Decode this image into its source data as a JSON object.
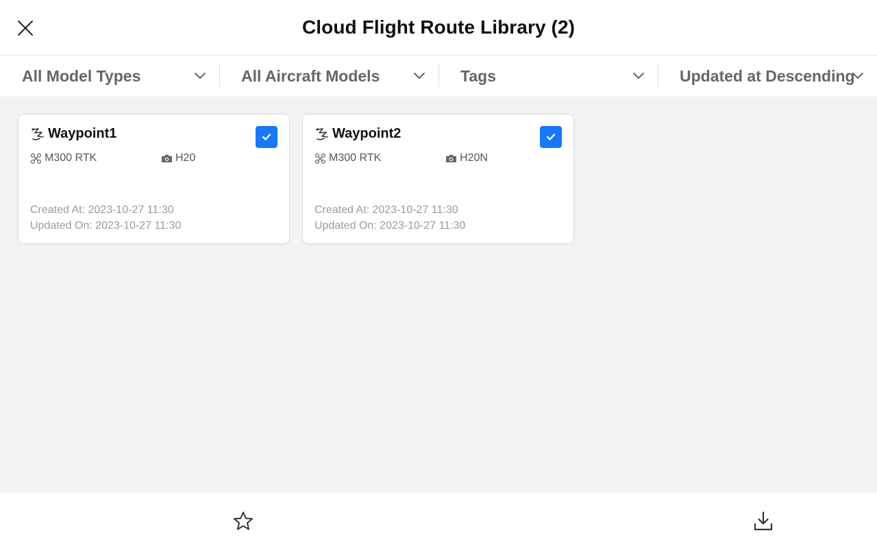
{
  "header": {
    "title": "Cloud Flight Route Library (2)"
  },
  "filters": [
    {
      "label": "All Model Types"
    },
    {
      "label": "All Aircraft Models"
    },
    {
      "label": "Tags"
    },
    {
      "label": "Updated at Descending"
    }
  ],
  "cards": [
    {
      "name": "Waypoint1",
      "aircraft": "M300 RTK",
      "camera": "H20",
      "created": "Created At: 2023-10-27 11:30",
      "updated": "Updated On: 2023-10-27 11:30",
      "checked": true
    },
    {
      "name": "Waypoint2",
      "aircraft": "M300 RTK",
      "camera": "H20N",
      "created": "Created At: 2023-10-27 11:30",
      "updated": "Updated On: 2023-10-27 11:30",
      "checked": true
    }
  ],
  "icons": {
    "close": "close-icon",
    "chevron": "chevron-down-icon",
    "route": "waypoint-route-icon",
    "drone": "drone-icon",
    "camera": "camera-icon",
    "check": "check-icon",
    "favorite": "star-icon",
    "download": "download-icon"
  },
  "colors": {
    "accent": "#1677ff",
    "background": "#f3f3f3"
  }
}
